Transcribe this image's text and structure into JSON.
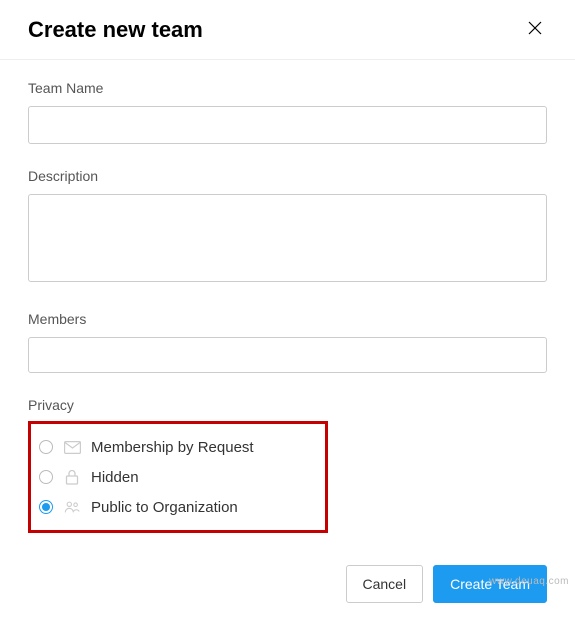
{
  "header": {
    "title": "Create new team"
  },
  "fields": {
    "team_name": {
      "label": "Team Name",
      "value": ""
    },
    "description": {
      "label": "Description",
      "value": ""
    },
    "members": {
      "label": "Members",
      "value": ""
    }
  },
  "privacy": {
    "label": "Privacy",
    "options": [
      {
        "label": "Membership by Request",
        "icon": "mail-icon"
      },
      {
        "label": "Hidden",
        "icon": "lock-icon"
      },
      {
        "label": "Public to Organization",
        "icon": "group-icon"
      }
    ],
    "selected_index": 2
  },
  "footer": {
    "cancel_label": "Cancel",
    "submit_label": "Create Team"
  },
  "watermark": "www.deuaq.com"
}
